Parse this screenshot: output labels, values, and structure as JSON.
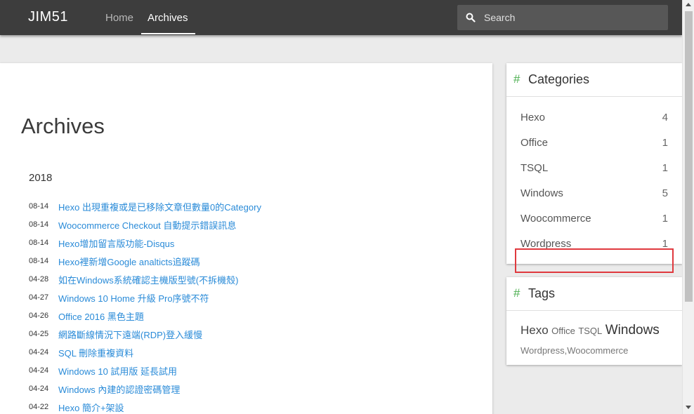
{
  "navbar": {
    "brand": "JIM51",
    "links": [
      {
        "label": "Home",
        "active": false
      },
      {
        "label": "Archives",
        "active": true
      }
    ],
    "search": {
      "placeholder": "Search"
    }
  },
  "main": {
    "title": "Archives",
    "year": "2018",
    "posts": [
      {
        "date": "08-14",
        "title": "Hexo 出現重複或是已移除文章但數量0的Category"
      },
      {
        "date": "08-14",
        "title": "Woocommerce Checkout 自動提示錯誤訊息"
      },
      {
        "date": "08-14",
        "title": "Hexo增加留言版功能-Disqus"
      },
      {
        "date": "08-14",
        "title": "Hexo裡新增Google analticts追蹤碼"
      },
      {
        "date": "04-28",
        "title": "如在Windows系統確認主機版型號(不拆機殼)"
      },
      {
        "date": "04-27",
        "title": "Windows 10 Home 升級 Pro序號不符"
      },
      {
        "date": "04-26",
        "title": "Office 2016 黑色主題"
      },
      {
        "date": "04-25",
        "title": "網路斷線情況下遠端(RDP)登入緩慢"
      },
      {
        "date": "04-24",
        "title": "SQL 刪除重複資料"
      },
      {
        "date": "04-24",
        "title": "Windows 10 試用版 延長試用"
      },
      {
        "date": "04-24",
        "title": "Windows 內建的認證密碼管理"
      },
      {
        "date": "04-22",
        "title": "Hexo 簡介+架設"
      }
    ]
  },
  "sidebar": {
    "categories": {
      "hash": "#",
      "title": "Categories",
      "items": [
        {
          "name": "Hexo",
          "count": "4"
        },
        {
          "name": "Office",
          "count": "1"
        },
        {
          "name": "TSQL",
          "count": "1"
        },
        {
          "name": "Windows",
          "count": "5"
        },
        {
          "name": "Woocommerce",
          "count": "1"
        },
        {
          "name": "Wordpress",
          "count": "1"
        }
      ]
    },
    "tags": {
      "hash": "#",
      "title": "Tags",
      "items": [
        "Hexo",
        "Office",
        "TSQL",
        "Windows",
        "Wordpress,Woocommerce"
      ]
    }
  },
  "colors": {
    "navbar": "#3d3d3d",
    "link": "#2a8bd8",
    "hash_accent": "#4caf50",
    "highlight": "#e0393e"
  }
}
